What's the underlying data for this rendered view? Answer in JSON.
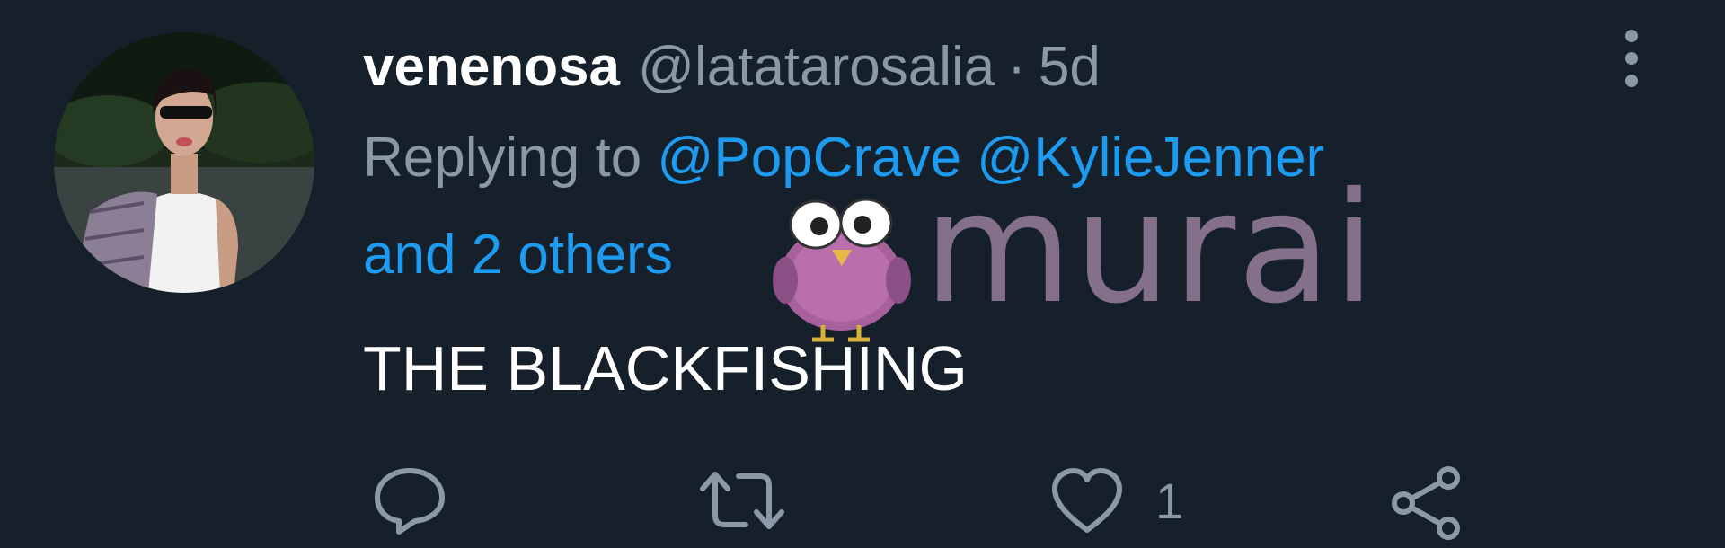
{
  "tweet": {
    "display_name": "venenosa",
    "handle": "@latatarosalia",
    "separator": "·",
    "time": "5d",
    "replying_prefix": "Replying to",
    "mentions": [
      "@PopCrave",
      "@KylieJenner"
    ],
    "others": "and 2 others",
    "text": "THE BLACKFISHING"
  },
  "watermark": {
    "text": "murai",
    "color": "#8a7590"
  },
  "actions": {
    "reply_icon": "reply-icon",
    "retweet_icon": "retweet-icon",
    "like_icon": "heart-icon",
    "like_count": "1",
    "share_icon": "share-icon"
  },
  "colors": {
    "background": "#15202b",
    "primary_text": "#ffffff",
    "secondary_text": "#8b98a5",
    "link": "#1d9bf0"
  }
}
